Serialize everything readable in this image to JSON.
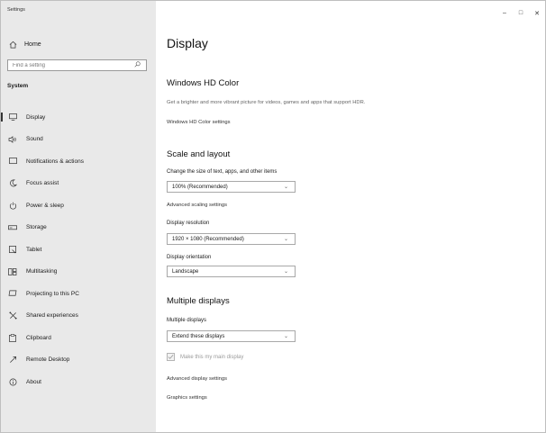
{
  "window": {
    "app_title": "Settings",
    "controls": {
      "minimize": "–",
      "maximize": "□",
      "close": "✕"
    }
  },
  "sidebar": {
    "home": {
      "label": "Home",
      "icon": "home-icon"
    },
    "search": {
      "placeholder": "Find a setting",
      "icon": "search-icon"
    },
    "section": "System",
    "items": [
      {
        "label": "Display",
        "icon": "display-icon",
        "active": true
      },
      {
        "label": "Sound",
        "icon": "sound-icon"
      },
      {
        "label": "Notifications & actions",
        "icon": "notifications-icon"
      },
      {
        "label": "Focus assist",
        "icon": "moon-icon"
      },
      {
        "label": "Power & sleep",
        "icon": "power-icon"
      },
      {
        "label": "Storage",
        "icon": "storage-icon"
      },
      {
        "label": "Tablet",
        "icon": "tablet-icon"
      },
      {
        "label": "Multitasking",
        "icon": "multitasking-icon"
      },
      {
        "label": "Projecting to this PC",
        "icon": "projecting-icon"
      },
      {
        "label": "Shared experiences",
        "icon": "shared-experiences-icon"
      },
      {
        "label": "Clipboard",
        "icon": "clipboard-icon"
      },
      {
        "label": "Remote Desktop",
        "icon": "remote-desktop-icon"
      },
      {
        "label": "About",
        "icon": "info-icon"
      }
    ]
  },
  "main": {
    "title": "Display",
    "hd_color": {
      "heading": "Windows HD Color",
      "description": "Get a brighter and more vibrant picture for videos, games and apps that support HDR.",
      "link": "Windows HD Color settings"
    },
    "scale": {
      "heading": "Scale and layout",
      "size_label": "Change the size of text, apps, and other items",
      "size_value": "100% (Recommended)",
      "advanced_link": "Advanced scaling settings",
      "resolution_label": "Display resolution",
      "resolution_value": "1920 × 1080 (Recommended)",
      "orientation_label": "Display orientation",
      "orientation_value": "Landscape"
    },
    "multiple": {
      "heading": "Multiple displays",
      "label": "Multiple displays",
      "value": "Extend these displays",
      "main_display_checkbox": "Make this my main display",
      "main_display_checked": true
    },
    "advanced_display_link": "Advanced display settings",
    "graphics_link": "Graphics settings"
  }
}
